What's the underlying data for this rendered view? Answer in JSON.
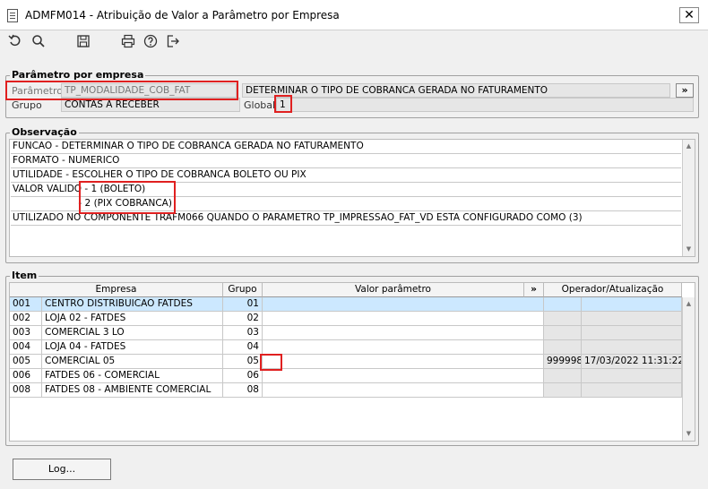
{
  "window": {
    "title": "ADMFM014 - Atribuição de Valor a Parâmetro por Empresa",
    "close_label": "✕"
  },
  "toolbar": {
    "icons": [
      "undo-icon",
      "search-icon",
      "save-icon",
      "print-icon",
      "help-icon",
      "exit-icon"
    ]
  },
  "param": {
    "section_title": "Parâmetro por empresa",
    "param_label": "Parâmetro",
    "param_value": "TP_MODALIDADE_COB_FAT",
    "description": "DETERMINAR O TIPO DE COBRANCA GERADA NO FATURAMENTO",
    "more_label": "»",
    "group_label": "Grupo",
    "group_value": "CONTAS A RECEBER",
    "global_label": "Global",
    "global_value": "1"
  },
  "observacao": {
    "section_title": "Observação",
    "lines": [
      "FUNCAO - DETERMINAR O TIPO DE COBRANCA GERADA NO FATURAMENTO",
      "FORMATO - NUMERICO",
      "UTILIDADE - ESCOLHER O TIPO DE COBRANCA BOLETO OU PIX",
      "VALOR VALIDO - 1 (BOLETO)",
      "                      - 2 (PIX COBRANCA)",
      "UTILIZADO NO COMPONENTE TRAFM066 QUANDO O PARAMETRO TP_IMPRESSAO_FAT_VD ESTA CONFIGURADO COMO (3)"
    ]
  },
  "item": {
    "section_title": "Item",
    "headers": {
      "empresa": "Empresa",
      "grupo": "Grupo",
      "valor": "Valor parâmetro",
      "more": "»",
      "operador": "Operador/Atualização"
    },
    "rows": [
      {
        "cod": "001",
        "nome": "CENTRO DISTRIBUICAO FATDES",
        "grupo": "01",
        "valor": "",
        "operador": "",
        "data": ""
      },
      {
        "cod": "002",
        "nome": "LOJA 02 - FATDES",
        "grupo": "02",
        "valor": "",
        "operador": "",
        "data": ""
      },
      {
        "cod": "003",
        "nome": "COMERCIAL 3 LO",
        "grupo": "03",
        "valor": "",
        "operador": "",
        "data": ""
      },
      {
        "cod": "004",
        "nome": "LOJA 04 - FATDES",
        "grupo": "04",
        "valor": "",
        "operador": "",
        "data": ""
      },
      {
        "cod": "005",
        "nome": "COMERCIAL 05",
        "grupo": "05",
        "valor": "",
        "operador": "999998",
        "data": "17/03/2022 11:31:22"
      },
      {
        "cod": "006",
        "nome": "FATDES 06 - COMERCIAL",
        "grupo": "06",
        "valor": "",
        "operador": "",
        "data": ""
      },
      {
        "cod": "008",
        "nome": "FATDES 08 - AMBIENTE COMERCIAL",
        "grupo": "08",
        "valor": "",
        "operador": "",
        "data": ""
      }
    ]
  },
  "footer": {
    "log_label": "Log..."
  },
  "colors": {
    "highlight": "#e02020",
    "selected_row": "#cce8ff",
    "readonly": "#e6e6e6"
  }
}
